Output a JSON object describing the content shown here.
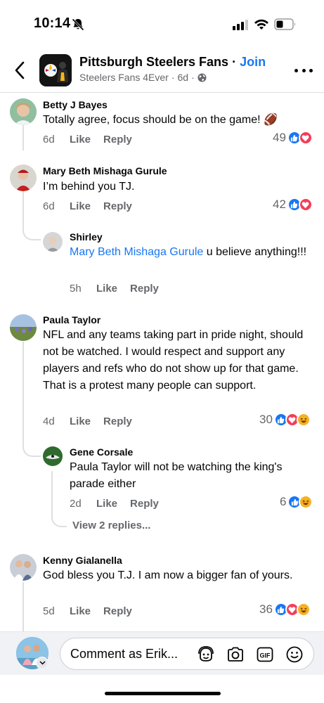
{
  "status_bar": {
    "time": "10:14",
    "icons": [
      "bell-slash-icon",
      "cellular-signal-icon",
      "wifi-icon",
      "battery-icon"
    ]
  },
  "header": {
    "group_name": "Pittsburgh Steelers Fans",
    "separator": " · ",
    "join_label": "Join",
    "subtitle_author": "Steelers Fans 4Ever",
    "subtitle_time": "6d",
    "subtitle_privacy_icon": "globe-icon"
  },
  "comments": [
    {
      "name": "Betty J Bayes",
      "text": "Totally agree, focus should be on the game!",
      "emoji": "🏈",
      "time": "6d",
      "like_label": "Like",
      "reply_label": "Reply",
      "reaction_count": "49",
      "reactions": [
        "like",
        "love"
      ]
    },
    {
      "name": "Mary Beth Mishaga Gurule",
      "text": "I’m behind you TJ.",
      "time": "6d",
      "like_label": "Like",
      "reply_label": "Reply",
      "reaction_count": "42",
      "reactions": [
        "like",
        "love"
      ],
      "replies": [
        {
          "name": "Shirley",
          "mention": "Mary Beth Mishaga Gurule",
          "text": " u believe anything!!!",
          "time": "5h",
          "like_label": "Like",
          "reply_label": "Reply"
        }
      ]
    },
    {
      "name": "Paula Taylor",
      "text": "NFL and any teams taking part in pride night, should not be watched.   I would respect and support any players and refs who do not show up for that game. That is a protest many people can support.",
      "time": "4d",
      "like_label": "Like",
      "reply_label": "Reply",
      "reaction_count": "30",
      "reactions": [
        "like",
        "love",
        "haha"
      ],
      "replies": [
        {
          "name": "Gene Corsale",
          "text": "Paula Taylor will not be watching the king's parade either",
          "time": "2d",
          "like_label": "Like",
          "reply_label": "Reply",
          "reaction_count": "6",
          "reactions": [
            "like",
            "haha"
          ]
        }
      ],
      "view_replies_label": "View 2 replies..."
    },
    {
      "name": "Kenny Gialanella",
      "text": "God bless you T.J.  I am now a bigger fan of yours.",
      "time": "5d",
      "like_label": "Like",
      "reply_label": "Reply",
      "reaction_count": "36",
      "reactions": [
        "like",
        "love",
        "haha"
      ]
    }
  ],
  "composer": {
    "placeholder": "Comment as Erik...",
    "icons": [
      "avatar-sticker-icon",
      "camera-icon",
      "gif-icon",
      "emoji-icon"
    ]
  },
  "colors": {
    "accent": "#1877f2",
    "secondary_text": "#65676b",
    "love": "#f33e58",
    "haha": "#f7b125"
  }
}
